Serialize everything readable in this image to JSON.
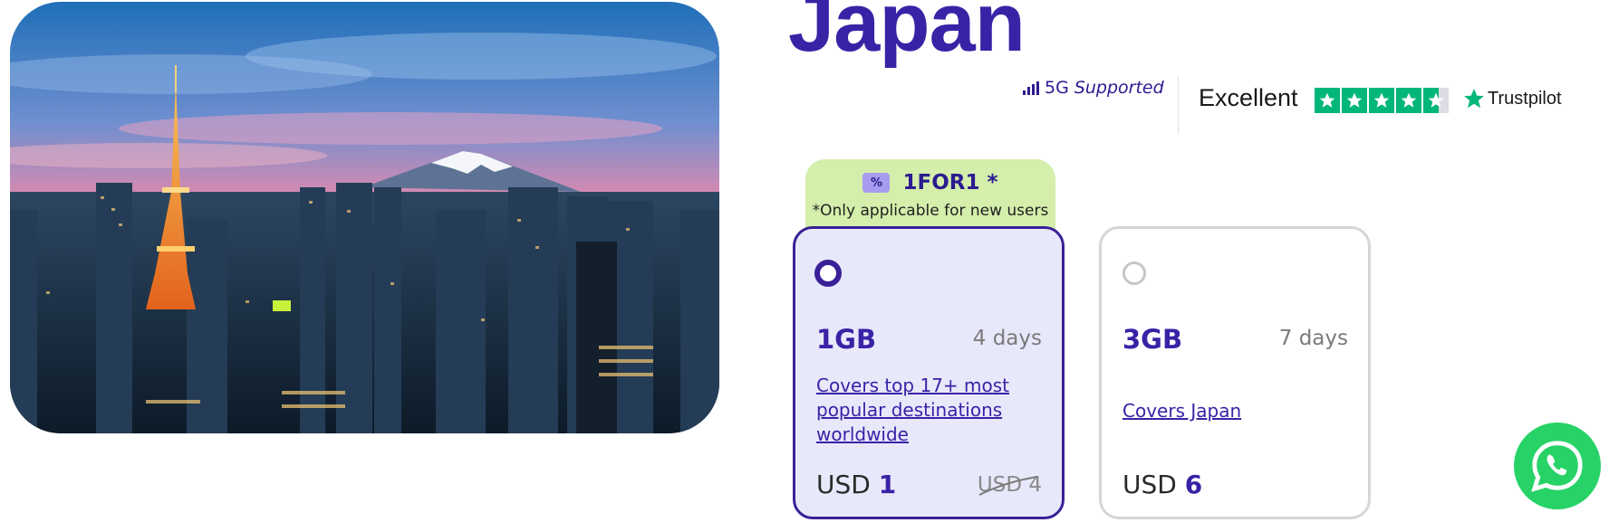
{
  "destination": {
    "title": "Japan"
  },
  "network": {
    "generation": "5G",
    "supported_label": "Supported"
  },
  "trustpilot": {
    "rating_label": "Excellent",
    "stars": 4.5,
    "brand": "Trustpilot",
    "color": "#00b67a"
  },
  "promo": {
    "code": "1FOR1 *",
    "note": "*Only applicable for new users",
    "icon": "discount-ticket-icon"
  },
  "plans": [
    {
      "data": "1GB",
      "duration": "4 days",
      "coverage": "Covers top 17+ most popular destinations worldwide",
      "currency": "USD",
      "price": "1",
      "original_price": "USD 4",
      "selected": true
    },
    {
      "data": "3GB",
      "duration": "7 days",
      "coverage": "Covers Japan",
      "currency": "USD",
      "price": "6",
      "selected": false
    }
  ],
  "colors": {
    "brand": "#3a22a6",
    "promo_bg": "#d4eeab",
    "selected_bg": "#e8e8fb",
    "whatsapp": "#27d367"
  },
  "icons": {
    "chat": "whatsapp-icon",
    "signal": "signal-bars-icon"
  }
}
